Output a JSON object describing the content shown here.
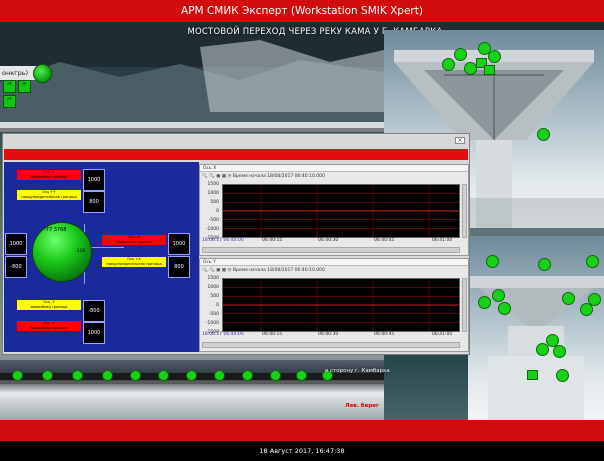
{
  "app": {
    "title": "АРМ СМИК Эксперт   (Workstation SMIK Xpert)"
  },
  "scene": {
    "subtitle": "МОСТОВОЙ ПЕРЕХОД ЧЕРЕЗ РЕКУ КАМА У Г. КАМБАРКА"
  },
  "left_widget": {
    "label": "онкгрь)",
    "boxes": [
      "ЛТ",
      "ЛТ",
      "ЛТ"
    ]
  },
  "axis_panel": {
    "z_top": {
      "critical": "Ось -Y",
      "critical_sub": "аварийная граница",
      "warn": "Ось +Y",
      "warn_sub": "предупредительная граница",
      "critical_val": "1000",
      "warn_val": "800"
    },
    "x_left_vals": [
      "1000",
      "-800"
    ],
    "x_right": {
      "critical": "Ось -X",
      "critical_sub": "аварийная граница",
      "warn": "Ось +X",
      "warn_sub": "предупредительная граница",
      "critical_val": "1000",
      "warn_val": "800"
    },
    "y_bottom": {
      "warn": "Ось -Y",
      "warn_sub": "аварийная граница",
      "critical": "Ось -Y",
      "critical_sub": "аварийная граница",
      "warn_val": "-800",
      "critical_val": "1000"
    },
    "ball_value": "-77.3768",
    "ball_value2": "-116"
  },
  "charts": [
    {
      "window_title": "Ось X",
      "timestamp_label": "Время начала 18/08/2017 06:40:10.000",
      "y_ticks": [
        "1500",
        "1000",
        "500",
        "0",
        "-500",
        "-1000",
        "-1500"
      ],
      "x_ticks": [
        "06:40:15",
        "06:40:30",
        "06:40:45",
        "06:41:00"
      ],
      "x_start": "18.08.17 06:40:00",
      "colors": {
        "grid": "#8a0a0a",
        "line": "#cc2222"
      }
    },
    {
      "window_title": "Ось Y",
      "timestamp_label": "Время начала 18/08/2017 06:40:10.000",
      "y_ticks": [
        "1500",
        "1000",
        "500",
        "0",
        "-500",
        "-1000",
        "-1500"
      ],
      "x_ticks": [
        "06:40:15",
        "06:40:30",
        "06:40:45",
        "06:41:00"
      ],
      "x_start": "18.08.17 06:40:00",
      "colors": {
        "grid": "#8a0a0a",
        "line": "#cc2222"
      }
    }
  ],
  "bridge": {
    "kama_label": "в сторону г. Камбарка",
    "left_bank": "Лев. берег"
  },
  "status": {
    "datetime": "18 Август 2017, 16:47:38"
  },
  "colors": {
    "brand_red": "#d10c0c",
    "status_green": "#19d119",
    "panel_blue": "#1a2a9c"
  }
}
